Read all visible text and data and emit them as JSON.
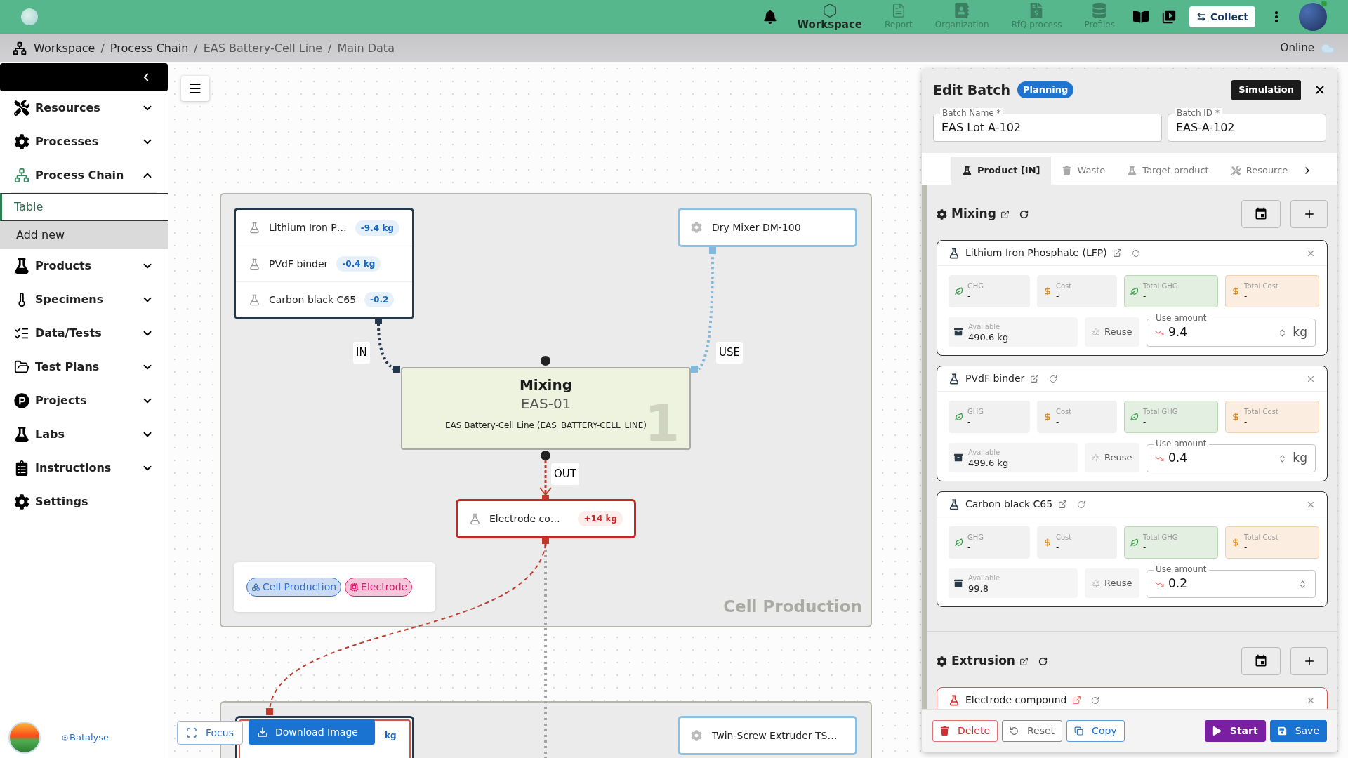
{
  "top_bar": {
    "nav": [
      {
        "label": "Workspace",
        "selected": true
      },
      {
        "label": "Report",
        "selected": false
      },
      {
        "label": "Organization",
        "selected": false
      },
      {
        "label": "RfQ process",
        "selected": false
      },
      {
        "label": "Profiles",
        "selected": false
      }
    ],
    "collect_button": "Collect"
  },
  "breadcrumb": {
    "separator": "/",
    "items": [
      {
        "label": "Workspace",
        "link": true
      },
      {
        "label": "Process Chain",
        "link": true
      },
      {
        "label": "EAS Battery-Cell Line",
        "link": false
      },
      {
        "label": "Main Data",
        "link": false
      }
    ],
    "status": "Online"
  },
  "sidebar": {
    "items": [
      {
        "label": "Resources",
        "kind": "group",
        "expanded": false
      },
      {
        "label": "Processes",
        "kind": "group",
        "expanded": false
      },
      {
        "label": "Process Chain",
        "kind": "group",
        "expanded": true,
        "children": [
          {
            "label": "Table",
            "selected": true
          },
          {
            "label": "Add new",
            "selected": false
          }
        ]
      },
      {
        "label": "Products",
        "kind": "group",
        "expanded": false
      },
      {
        "label": "Specimens",
        "kind": "group",
        "expanded": false
      },
      {
        "label": "Data/Tests",
        "kind": "group",
        "expanded": false
      },
      {
        "label": "Test Plans",
        "kind": "group",
        "expanded": false
      },
      {
        "label": "Projects",
        "kind": "group",
        "expanded": false
      },
      {
        "label": "Labs",
        "kind": "group",
        "expanded": false
      },
      {
        "label": "Instructions",
        "kind": "group",
        "expanded": false
      },
      {
        "label": "Settings",
        "kind": "link"
      }
    ],
    "footer_link": "Batalyse"
  },
  "canvas": {
    "stage": {
      "title": "Cell Production",
      "tags": [
        {
          "label": "Cell Production",
          "color": "#2f6fcf"
        },
        {
          "label": "Electrode",
          "color": "#d81b6a"
        }
      ],
      "input_node": {
        "kind": "input",
        "items": [
          {
            "name": "Lithium Iron P…",
            "amount": "-9.4 kg"
          },
          {
            "name": "PVdF binder",
            "amount": "-0.4 kg"
          },
          {
            "name": "Carbon black C65",
            "amount": "-0.2"
          }
        ]
      },
      "resource_node": {
        "name": "Dry Mixer DM-100"
      },
      "process_node": {
        "title": "Mixing",
        "code": "EAS-01",
        "line": "EAS Battery-Cell Line (EAS_BATTERY-CELL_LINE)",
        "number": "1"
      },
      "output_node": {
        "kind": "output",
        "items": [
          {
            "name": "Electrode co…",
            "amount": "+14 kg"
          }
        ]
      },
      "edge_labels": {
        "in": "IN",
        "use": "USE",
        "out": "OUT"
      }
    },
    "next_stage": {
      "input_node": {
        "kind": "input",
        "amount": "kg"
      },
      "resource_node": {
        "name": "Twin-Screw Extruder TS…"
      }
    },
    "focus_button": "Focus",
    "download_button": "Download Image"
  },
  "edit_batch": {
    "title": "Edit Batch",
    "status": "Planning",
    "mode_button": "Simulation",
    "fields": [
      {
        "label": "Batch Name *",
        "value": "EAS Lot A-102"
      },
      {
        "label": "Batch ID *",
        "value": "EAS-A-102"
      }
    ],
    "tabs": [
      {
        "label": "Product [IN]",
        "selected": true
      },
      {
        "label": "Waste",
        "selected": false
      },
      {
        "label": "Target product",
        "selected": false
      },
      {
        "label": "Resource",
        "selected": false
      }
    ],
    "sections": [
      {
        "title": "Mixing",
        "products": [
          {
            "name": "Lithium Iron Phosphate (LFP)",
            "kind": "input",
            "metrics": [
              {
                "kind": "ghg",
                "label": "GHG",
                "value": "-"
              },
              {
                "kind": "cost",
                "label": "Cost",
                "value": "-"
              },
              {
                "kind": "total_ghg",
                "label": "Total GHG",
                "value": "-"
              },
              {
                "kind": "total_cost",
                "label": "Total Cost",
                "value": "-"
              }
            ],
            "available": {
              "label": "Available",
              "value": "490.6 kg"
            },
            "reuse": "Reuse",
            "use_amount": {
              "label": "Use amount",
              "value": "9.4",
              "unit": "kg"
            }
          },
          {
            "name": "PVdF binder",
            "kind": "input",
            "metrics": [
              {
                "kind": "ghg",
                "label": "GHG",
                "value": "-"
              },
              {
                "kind": "cost",
                "label": "Cost",
                "value": "-"
              },
              {
                "kind": "total_ghg",
                "label": "Total GHG",
                "value": "-"
              },
              {
                "kind": "total_cost",
                "label": "Total Cost",
                "value": "-"
              }
            ],
            "available": {
              "label": "Available",
              "value": "499.6 kg"
            },
            "reuse": "Reuse",
            "use_amount": {
              "label": "Use amount",
              "value": "0.4",
              "unit": "kg"
            }
          },
          {
            "name": "Carbon black C65",
            "kind": "input",
            "metrics": [
              {
                "kind": "ghg",
                "label": "GHG",
                "value": "-"
              },
              {
                "kind": "cost",
                "label": "Cost",
                "value": "-"
              },
              {
                "kind": "total_ghg",
                "label": "Total GHG",
                "value": "-"
              },
              {
                "kind": "total_cost",
                "label": "Total Cost",
                "value": "-"
              }
            ],
            "available": {
              "label": "Available",
              "value": "99.8"
            },
            "reuse": "Reuse",
            "use_amount": {
              "label": "Use amount",
              "value": "0.2"
            }
          }
        ]
      },
      {
        "title": "Extrusion",
        "products": [
          {
            "name": "Electrode compound",
            "kind": "output"
          }
        ]
      }
    ],
    "actions": [
      {
        "label": "Delete",
        "kind": "delete"
      },
      {
        "label": "Reset",
        "kind": "reset"
      },
      {
        "label": "Copy",
        "kind": "copy"
      },
      {
        "label": "Start",
        "kind": "start"
      },
      {
        "label": "Save",
        "kind": "save"
      }
    ]
  }
}
